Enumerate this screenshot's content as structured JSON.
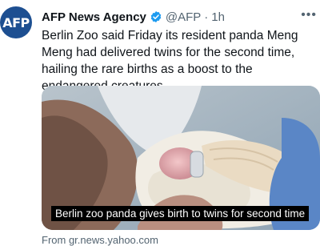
{
  "account": {
    "name": "AFP News Agency",
    "handle": "@AFP",
    "separator": "·",
    "time": "1h",
    "avatar_text": "AFP",
    "more_label": "•••"
  },
  "tweet": {
    "text": "Berlin Zoo said Friday its resident panda Meng Meng had delivered twins for the second time, hailing the rare births as a boost to the endangered creatures."
  },
  "media": {
    "caption": "Berlin zoo panda gives birth to twins for second time"
  },
  "link": {
    "source": "From gr.news.yahoo.com"
  },
  "colors": {
    "brand": "#1d4f91",
    "verified": "#1d9bf0",
    "secondary_text": "#536471"
  },
  "icons": [
    "verified-badge-icon",
    "more-options-icon"
  ]
}
